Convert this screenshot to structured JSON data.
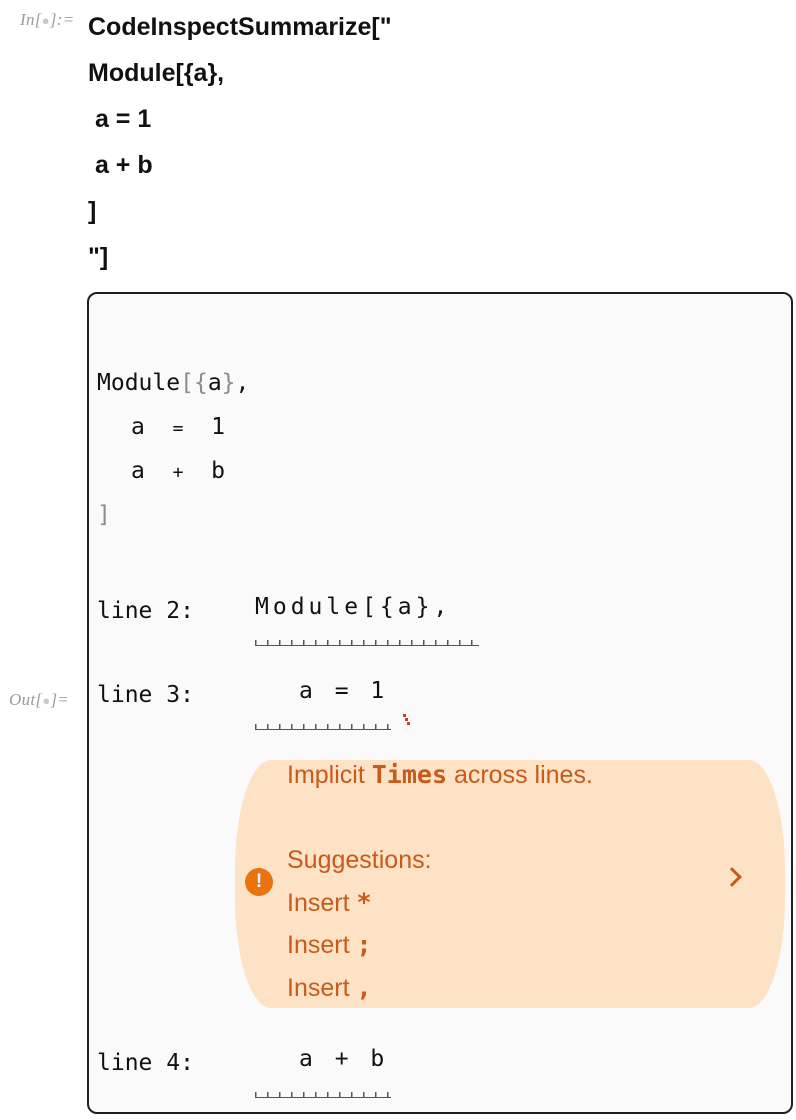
{
  "input_label": {
    "prefix": "In[",
    "marker": "●",
    "suffix": "]:="
  },
  "output_label": {
    "prefix": "Out[",
    "marker": "●",
    "suffix": "]="
  },
  "input_lines": [
    "CodeInspectSummarize[\"",
    "Module[{a},",
    " a = 1",
    " a + b",
    "]",
    "\"]"
  ],
  "output": {
    "source": {
      "line1": {
        "fn": "Module",
        "lb": "[",
        "lbrace": "{",
        "var": "a",
        "rbrace": "}",
        "comma": ","
      },
      "line2": {
        "lhs": "a",
        "op": "=",
        "rhs": "1"
      },
      "line3": {
        "lhs": "a",
        "op": "+",
        "rhs": "b"
      },
      "line4": {
        "rb": "]"
      }
    },
    "issues": [
      {
        "label": "line 2:",
        "code": "Module[{a},"
      },
      {
        "label": "line 3:",
        "code": "a = 1"
      },
      {
        "label": "line 4:",
        "code": "a + b"
      }
    ],
    "hint": {
      "message_prefix": "Implicit ",
      "message_keyword": "Times",
      "message_suffix": " across lines.",
      "suggestions_heading": "Suggestions:",
      "suggestions": [
        {
          "text": "Insert ",
          "symbol": "*"
        },
        {
          "text": "Insert ",
          "symbol": ";"
        },
        {
          "text": "Insert ",
          "symbol": ","
        }
      ],
      "colors": {
        "background": "#fde2c6",
        "text": "#c85a1a",
        "icon": "#e8730f",
        "error_mark": "#e0342b"
      },
      "icons": {
        "warning": "exclamation-circle-icon",
        "expand": "chevron-right-icon"
      }
    }
  }
}
